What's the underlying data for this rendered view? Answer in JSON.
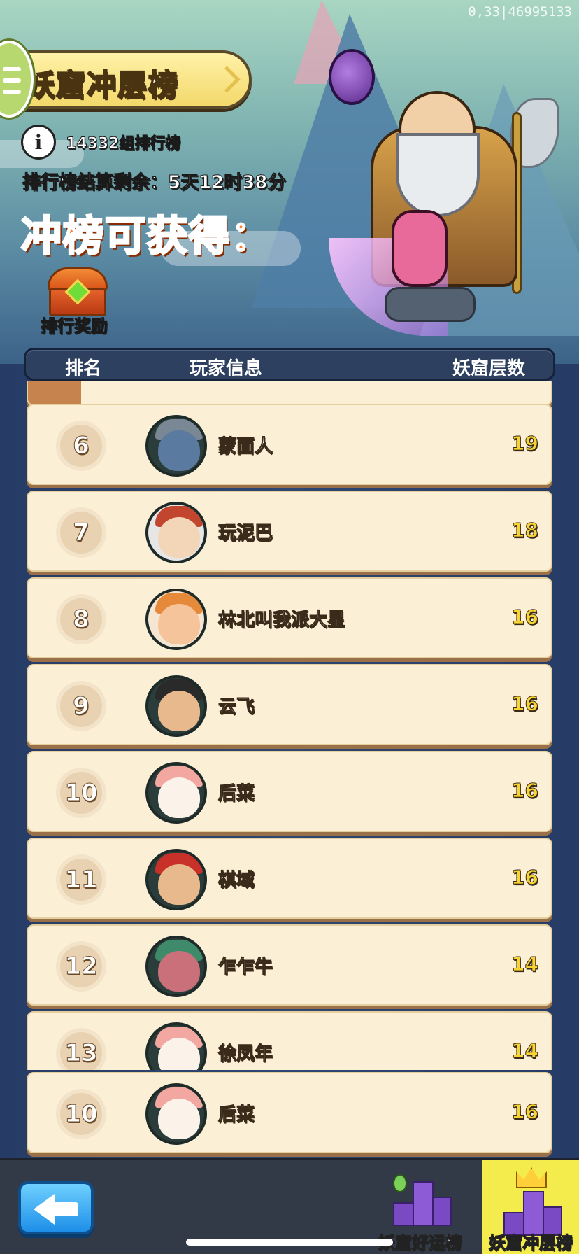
{
  "debug_id": "0,33|46995133",
  "header": {
    "title": "妖窟冲层榜",
    "group_info": "14332组排行榜",
    "countdown": "排行榜结算剩余：5天12时38分",
    "reward_title": "冲榜可获得：",
    "reward_label": "排行奖励"
  },
  "table": {
    "col_rank": "排名",
    "col_player": "玩家信息",
    "col_floors": "妖窟层数"
  },
  "rows": [
    {
      "rank": "6",
      "name": "蒙面人",
      "floors": "19",
      "avatar": "masked-warrior"
    },
    {
      "rank": "7",
      "name": "玩泥巴",
      "floors": "18",
      "avatar": "crowned-boy"
    },
    {
      "rank": "8",
      "name": "林北叫我派大星",
      "floors": "16",
      "avatar": "fox"
    },
    {
      "rank": "9",
      "name": "云飞",
      "floors": "16",
      "avatar": "headband-soldier"
    },
    {
      "rank": "10",
      "name": "后菜",
      "floors": "16",
      "avatar": "lucky-cat"
    },
    {
      "rank": "11",
      "name": "棋域",
      "floors": "16",
      "avatar": "red-helmet-general"
    },
    {
      "rank": "12",
      "name": "乍乍牛",
      "floors": "14",
      "avatar": "bull-demon"
    },
    {
      "rank": "13",
      "name": "徐凤年",
      "floors": "14",
      "avatar": "lucky-cat"
    }
  ],
  "self_row": {
    "rank": "10",
    "name": "后菜",
    "floors": "16",
    "avatar": "lucky-cat"
  },
  "bottom": {
    "tab_lucky": "妖窟好运榜",
    "tab_climb": "妖窟冲层榜"
  },
  "colors": {
    "row_bg": "#fbf0d6",
    "floor_value": "#f7d431",
    "active_tab": "#f3ec4c",
    "back_button": "#1e8fe8"
  }
}
